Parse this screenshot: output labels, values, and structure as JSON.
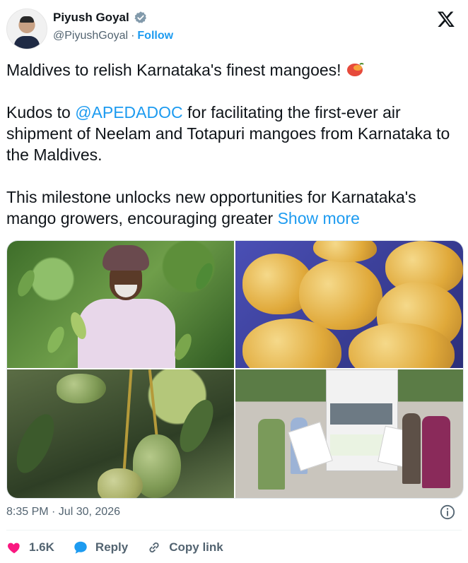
{
  "author": {
    "name": "Piyush Goyal",
    "handle": "@PiyushGoyal",
    "separator": "·",
    "follow_label": "Follow"
  },
  "tweet": {
    "line1": "Maldives to relish Karnataka's finest mangoes!",
    "p2_prefix": "Kudos to ",
    "p2_mention": "@APEDADOC",
    "p2_suffix": " for facilitating the first-ever air shipment of Neelam and Totapuri mangoes from Karnataka to the Maldives.",
    "p3_text": "This milestone unlocks new opportunities for Karnataka's mango growers, encouraging greater ",
    "show_more": "Show more"
  },
  "meta": {
    "timestamp": "8:35 PM · Jul 30, 2026"
  },
  "actions": {
    "like_count": "1.6K",
    "reply_label": "Reply",
    "copy_link_label": "Copy link"
  },
  "colors": {
    "accent": "#1d9bf0",
    "like": "#f91880",
    "muted": "#536471"
  }
}
